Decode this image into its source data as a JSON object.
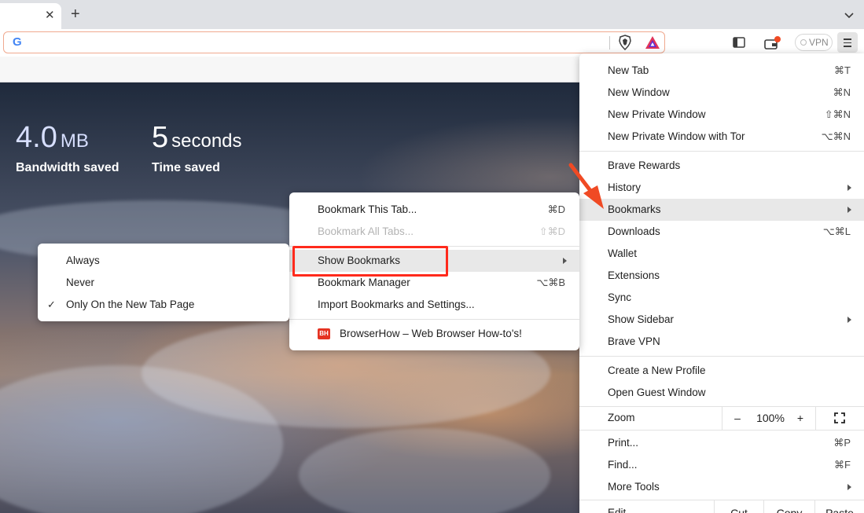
{
  "browser": {
    "tab_close": "✕",
    "new_tab": "+",
    "vpn_label": "VPN",
    "omnibox_icon": "G"
  },
  "ntp": {
    "bandwidth_value": "4.0",
    "bandwidth_unit": "MB",
    "bandwidth_label": "Bandwidth saved",
    "time_value": "5",
    "time_unit": "seconds",
    "time_label": "Time saved"
  },
  "main_menu": {
    "new_tab": {
      "label": "New Tab",
      "shortcut": "⌘T"
    },
    "new_window": {
      "label": "New Window",
      "shortcut": "⌘N"
    },
    "new_private_window": {
      "label": "New Private Window",
      "shortcut": "⇧⌘N"
    },
    "new_private_tor": {
      "label": "New Private Window with Tor",
      "shortcut": "⌥⌘N"
    },
    "brave_rewards": {
      "label": "Brave Rewards"
    },
    "history": {
      "label": "History"
    },
    "bookmarks": {
      "label": "Bookmarks"
    },
    "downloads": {
      "label": "Downloads",
      "shortcut": "⌥⌘L"
    },
    "wallet": {
      "label": "Wallet"
    },
    "extensions": {
      "label": "Extensions"
    },
    "sync": {
      "label": "Sync"
    },
    "show_sidebar": {
      "label": "Show Sidebar"
    },
    "brave_vpn": {
      "label": "Brave VPN"
    },
    "create_profile": {
      "label": "Create a New Profile"
    },
    "guest_window": {
      "label": "Open Guest Window"
    },
    "zoom": {
      "label": "Zoom",
      "minus": "–",
      "value": "100%",
      "plus": "+"
    },
    "print": {
      "label": "Print...",
      "shortcut": "⌘P"
    },
    "find": {
      "label": "Find...",
      "shortcut": "⌘F"
    },
    "more_tools": {
      "label": "More Tools"
    },
    "edit": {
      "label": "Edit",
      "cut": "Cut",
      "copy": "Copy",
      "paste": "Paste"
    }
  },
  "bookmarks_menu": {
    "bookmark_tab": {
      "label": "Bookmark This Tab...",
      "shortcut": "⌘D"
    },
    "bookmark_all": {
      "label": "Bookmark All Tabs...",
      "shortcut": "⇧⌘D"
    },
    "show_bookmarks": {
      "label": "Show Bookmarks"
    },
    "manager": {
      "label": "Bookmark Manager",
      "shortcut": "⌥⌘B"
    },
    "import": {
      "label": "Import Bookmarks and Settings..."
    },
    "browserhow": {
      "label": "BrowserHow – Web Browser How-to's!",
      "favicon": "BH"
    }
  },
  "show_bookmarks_menu": {
    "always": "Always",
    "never": "Never",
    "only_ntp": "Only On the New Tab Page",
    "check": "✓"
  },
  "colors": {
    "highlight_box": "#ff2a1c",
    "pointer_arrow": "#f04a24"
  }
}
